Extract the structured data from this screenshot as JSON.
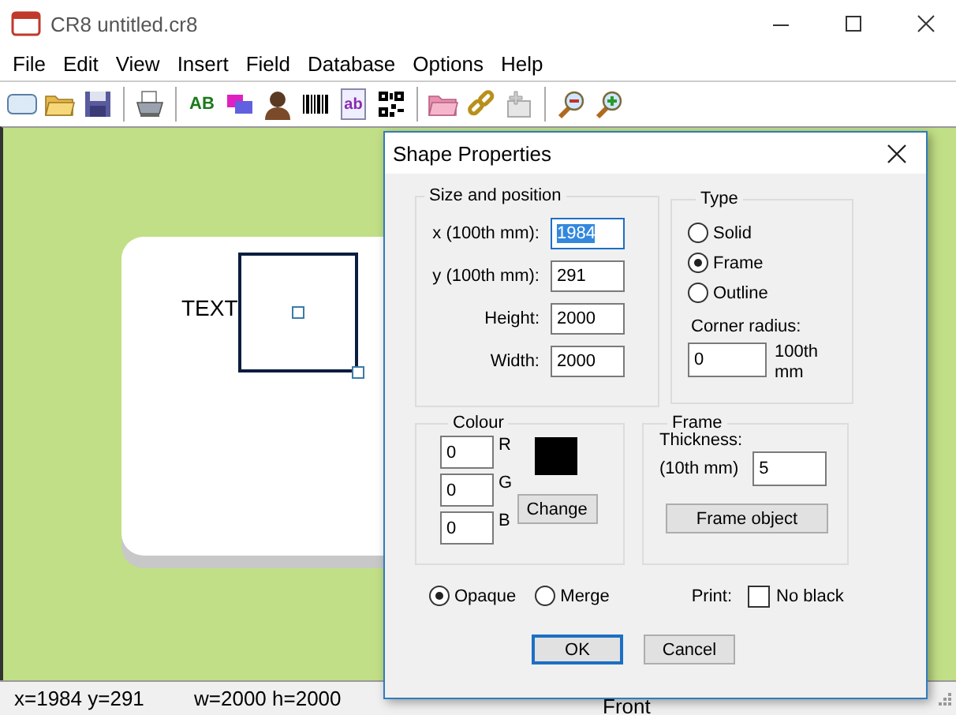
{
  "window": {
    "title": "CR8 untitled.cr8"
  },
  "menu": [
    "File",
    "Edit",
    "View",
    "Insert",
    "Field",
    "Database",
    "Options",
    "Help"
  ],
  "toolbar": [
    [
      {
        "kind": "card"
      },
      {
        "kind": "open"
      },
      {
        "kind": "save"
      }
    ],
    [
      {
        "kind": "print"
      }
    ],
    [
      {
        "kind": "text",
        "glyph": "AB"
      },
      {
        "kind": "shape"
      },
      {
        "kind": "photo"
      },
      {
        "kind": "barcode"
      },
      {
        "kind": "textimage",
        "glyph": "ab"
      },
      {
        "kind": "qr"
      }
    ],
    [
      {
        "kind": "folder"
      },
      {
        "kind": "link"
      },
      {
        "kind": "add"
      }
    ],
    [
      {
        "kind": "zoomout"
      },
      {
        "kind": "zoomin"
      }
    ]
  ],
  "canvas": {
    "card_text": "TEXT"
  },
  "status_bar": {
    "position": "x=1984  y=291",
    "size": "w=2000  h=2000",
    "side": "Front"
  },
  "dialog": {
    "title": "Shape Properties",
    "size_position": {
      "title": "Size and position",
      "fields": [
        {
          "label": "x (100th mm):",
          "value": "1984",
          "focused": true
        },
        {
          "label": "y (100th mm):",
          "value": "291",
          "focused": false
        },
        {
          "label": "Height:",
          "value": "2000",
          "focused": false
        },
        {
          "label": "Width:",
          "value": "2000",
          "focused": false
        }
      ]
    },
    "type": {
      "title": "Type",
      "options": [
        {
          "label": "Solid",
          "selected": false
        },
        {
          "label": "Frame",
          "selected": true
        },
        {
          "label": "Outline",
          "selected": false
        }
      ],
      "corner_label": "Corner radius:",
      "corner_value": "0",
      "corner_unit": "100th mm"
    },
    "colour": {
      "title": "Colour",
      "channels": [
        {
          "value": "0",
          "label": "R"
        },
        {
          "value": "0",
          "label": "G"
        },
        {
          "value": "0",
          "label": "B"
        }
      ],
      "button": "Change"
    },
    "frame": {
      "title": "Frame",
      "thickness_label": "Thickness:",
      "unit_label": "(10th mm)",
      "value": "5",
      "button": "Frame object"
    },
    "blend": [
      {
        "label": "Opaque",
        "selected": true
      },
      {
        "label": "Merge",
        "selected": false
      }
    ],
    "print": {
      "label": "Print:",
      "option": "No black",
      "checked": false
    },
    "buttons": [
      {
        "label": "OK",
        "default": true
      },
      {
        "label": "Cancel",
        "default": false
      }
    ]
  }
}
